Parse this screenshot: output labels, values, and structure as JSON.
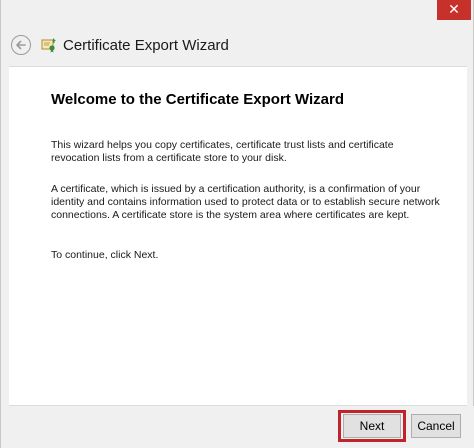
{
  "window": {
    "title": "Certificate Export Wizard",
    "close_symbol": "✕"
  },
  "icons": {
    "back": "back-arrow-icon",
    "app": "certificate-icon",
    "close": "close-icon"
  },
  "content": {
    "heading": "Welcome to the Certificate Export Wizard",
    "paragraph1": "This wizard helps you copy certificates, certificate trust lists and certificate revocation lists from a certificate store to your disk.",
    "paragraph2": "A certificate, which is issued by a certification authority, is a confirmation of your identity and contains information used to protect data or to establish secure network connections. A certificate store is the system area where certificates are kept.",
    "paragraph3": "To continue, click Next."
  },
  "buttons": {
    "next": "Next",
    "cancel": "Cancel"
  },
  "colors": {
    "close_bg": "#c7312b",
    "highlight_border": "#c0242a"
  }
}
